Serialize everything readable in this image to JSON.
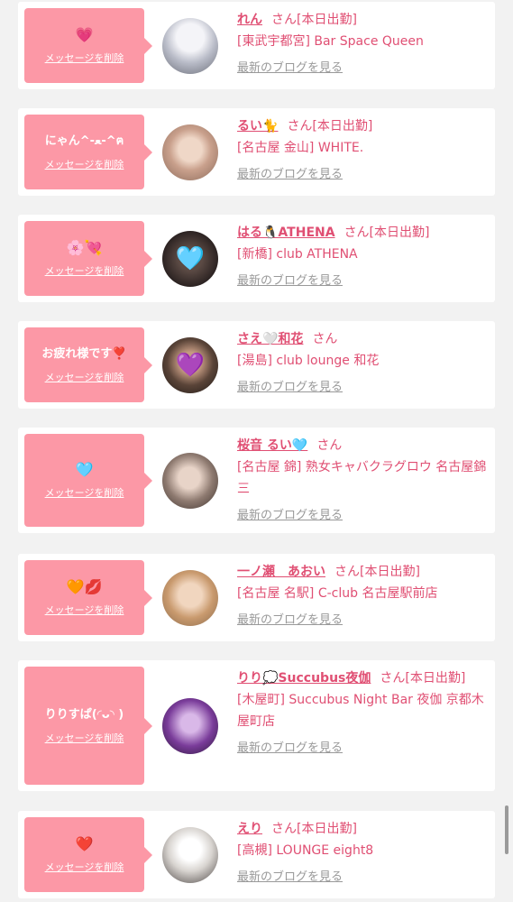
{
  "delete_label": "メッセージを削除",
  "blog_label": "最新のブログを見る",
  "colors": {
    "message_box": "#fc98a6",
    "accent_text": "#e04f73",
    "link_grey": "#999999",
    "background": "#f2f2f2"
  },
  "items": [
    {
      "message": "💗",
      "name": "れん",
      "suffix": "さん[本日出勤]",
      "shop": "[東武宇都宮] Bar Space Queen",
      "avatar_icon": "photo-avatar"
    },
    {
      "message": "にゃん^-ﻌ-^ฅ",
      "name": "るい🐈",
      "suffix": "さん[本日出勤]",
      "shop": "[名古屋 金山] WHITE.",
      "avatar_icon": "photo-avatar"
    },
    {
      "message": "🌸💘",
      "name": "はる🐧ATHENA",
      "suffix": "さん[本日出勤]",
      "shop": "[新橋] club ATHENA",
      "avatar_icon": "blue-heart-icon"
    },
    {
      "message": "お疲れ様です❣️",
      "name": "さえ🤍和花",
      "suffix": "さん",
      "shop": "[湯島] club lounge 和花",
      "avatar_icon": "purple-heart-icon"
    },
    {
      "message": "🩵",
      "name": "桜音 るい🩵",
      "suffix": "さん",
      "shop": "[名古屋 錦] 熟女キャバクラグロウ 名古屋錦三",
      "avatar_icon": "photo-avatar"
    },
    {
      "message": "🧡💋",
      "name": "一ノ瀬　あおい",
      "suffix": "さん[本日出勤]",
      "shop": "[名古屋 名駅] C-club 名古屋駅前店",
      "avatar_icon": "photo-avatar"
    },
    {
      "message": "りりすぱ(◜ᴗ◝ )",
      "name": "りり💭Succubus夜伽",
      "suffix": "さん[本日出勤]",
      "shop": "[木屋町] Succubus Night Bar 夜伽 京都木屋町店",
      "avatar_icon": "photo-avatar"
    },
    {
      "message": "❤️",
      "name": "えり",
      "suffix": "さん[本日出勤]",
      "shop": "[高槻] LOUNGE eight8",
      "avatar_icon": "photo-avatar"
    }
  ]
}
